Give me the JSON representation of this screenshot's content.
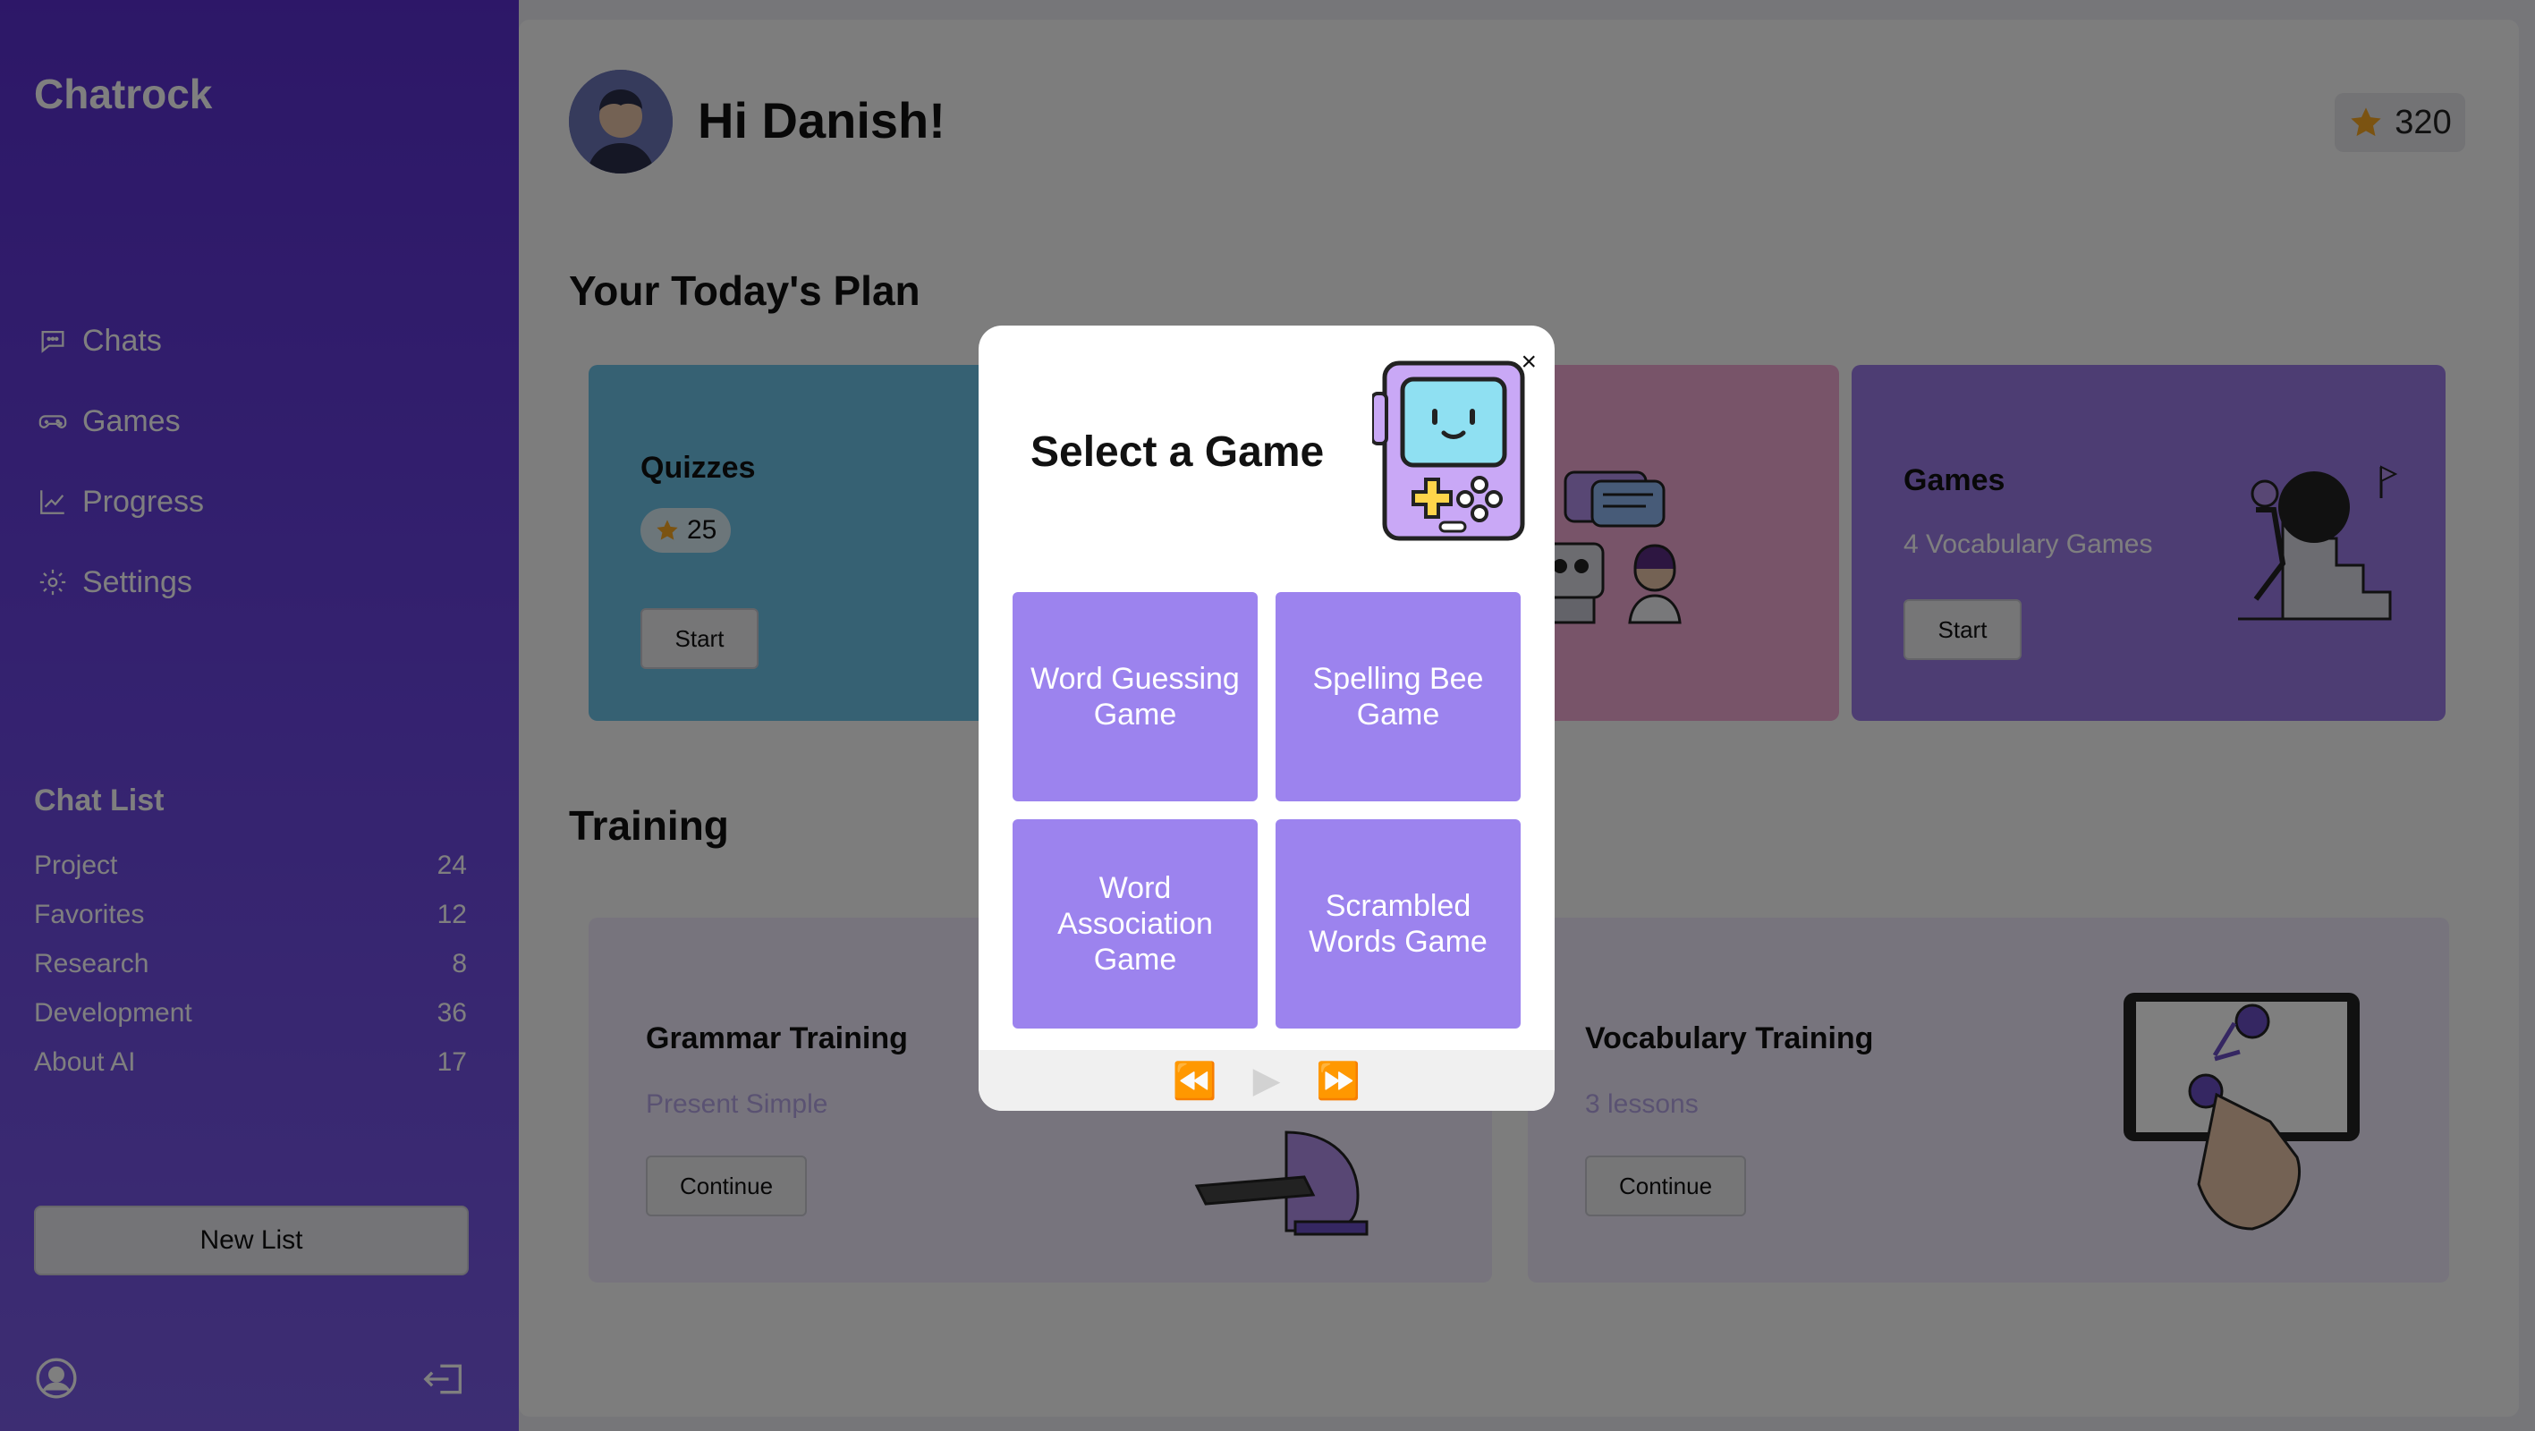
{
  "sidebar": {
    "brand": "Chatrock",
    "nav": [
      {
        "label": "Chats",
        "icon": "chat-bubble-icon"
      },
      {
        "label": "Games",
        "icon": "gamepad-icon"
      },
      {
        "label": "Progress",
        "icon": "chart-line-icon"
      },
      {
        "label": "Settings",
        "icon": "gear-icon"
      }
    ],
    "chat_list_title": "Chat List",
    "chat_list": [
      {
        "name": "Project",
        "count": "24"
      },
      {
        "name": "Favorites",
        "count": "12"
      },
      {
        "name": "Research",
        "count": "8"
      },
      {
        "name": "Development",
        "count": "36"
      },
      {
        "name": "About AI",
        "count": "17"
      }
    ],
    "new_list_label": "New List"
  },
  "header": {
    "greeting": "Hi Danish!",
    "points": "320"
  },
  "plan": {
    "title": "Your Today's Plan",
    "cards": [
      {
        "title": "Quizzes",
        "points": "25",
        "button": "Start",
        "color": "#6cc2e6"
      },
      {
        "title": "",
        "color": "#f1a8d2"
      },
      {
        "title": "Games",
        "subtitle": "4 Vocabulary Games",
        "button": "Start",
        "color": "#9a7be6"
      }
    ]
  },
  "training": {
    "title": "Training",
    "cards": [
      {
        "title": "Grammar Training",
        "subtitle": "Present Simple",
        "button": "Continue"
      },
      {
        "title": "Vocabulary Training",
        "subtitle": "3 lessons",
        "button": "Continue"
      }
    ]
  },
  "modal": {
    "title": "Select a Game",
    "close": "×",
    "games": [
      "Word Guessing Game",
      "Spelling Bee Game",
      "Word Association Game",
      "Scrambled Words Game"
    ]
  },
  "colors": {
    "sidebar": "#5a2fd0",
    "game_button": "#9c83ee",
    "overlay": "rgba(0,0,0,0.5)"
  }
}
